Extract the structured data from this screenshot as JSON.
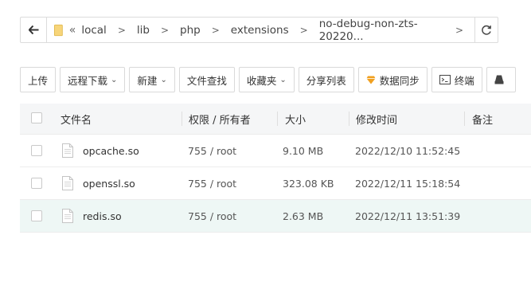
{
  "pathbar": {
    "crumbs": [
      "local",
      "lib",
      "php",
      "extensions",
      "no-debug-non-zts-20220..."
    ]
  },
  "toolbar": {
    "upload": "上传",
    "remote_download": "远程下载",
    "new": "新建",
    "file_search": "文件查找",
    "favorites": "收藏夹",
    "share_list": "分享列表",
    "data_sync": "数据同步",
    "terminal": "终端"
  },
  "table": {
    "headers": {
      "name": "文件名",
      "perm": "权限 / 所有者",
      "size": "大小",
      "mtime": "修改时间",
      "note": "备注"
    },
    "rows": [
      {
        "name": "opcache.so",
        "perm": "755 / root",
        "size": "9.10 MB",
        "mtime": "2022/12/10 11:52:45"
      },
      {
        "name": "openssl.so",
        "perm": "755 / root",
        "size": "323.08 KB",
        "mtime": "2022/12/11 15:18:54"
      },
      {
        "name": "redis.so",
        "perm": "755 / root",
        "size": "2.63 MB",
        "mtime": "2022/12/11 13:51:39"
      }
    ]
  },
  "colors": {
    "selected_row": "#eef7f5",
    "header_bg": "#f5f6f7",
    "folder": "#f7d57a",
    "sync_icon": "#f0a020"
  }
}
